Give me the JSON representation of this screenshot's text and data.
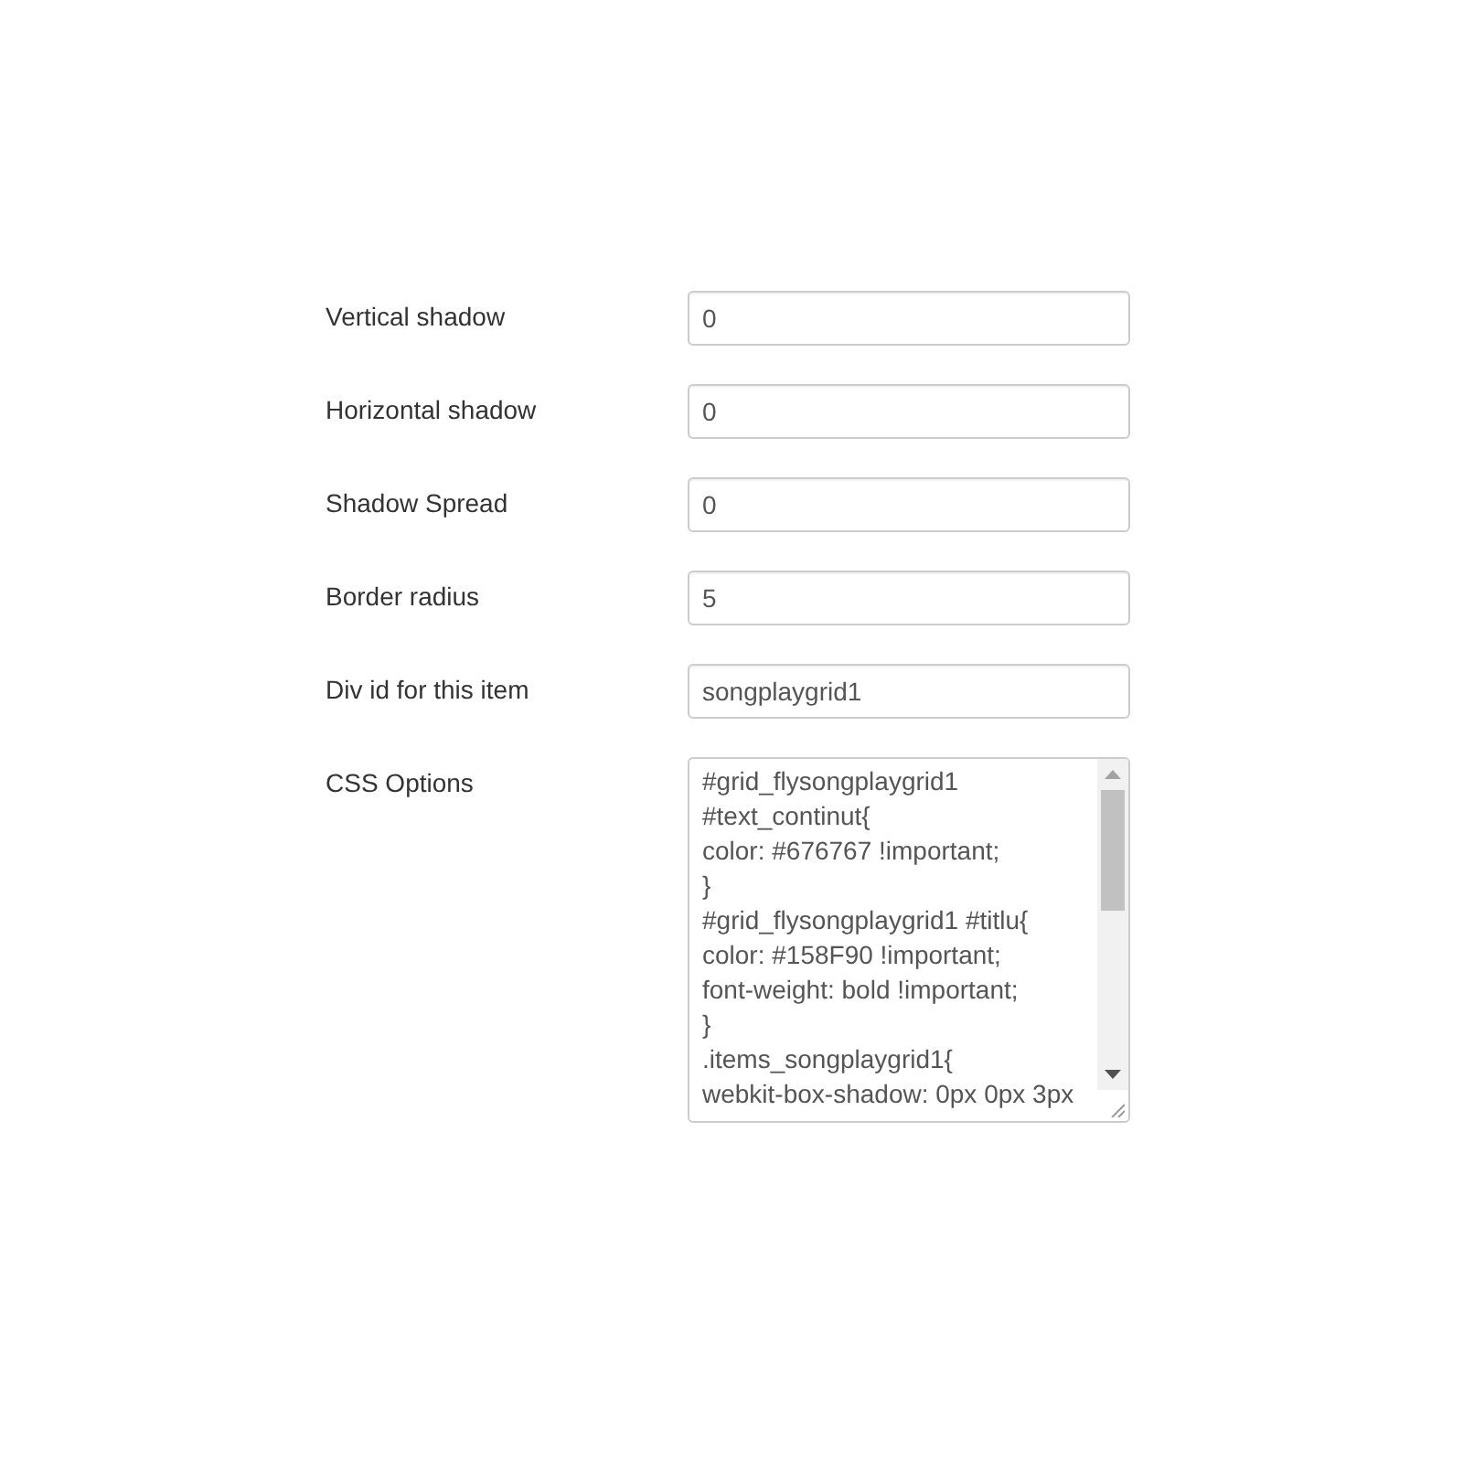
{
  "form": {
    "fields": [
      {
        "kind": "text",
        "label": "Vertical shadow",
        "value": "0"
      },
      {
        "kind": "text",
        "label": "Horizontal shadow",
        "value": "0"
      },
      {
        "kind": "text",
        "label": "Shadow Spread",
        "value": "0"
      },
      {
        "kind": "text",
        "label": "Border radius",
        "value": "5"
      },
      {
        "kind": "text",
        "label": "Div id for this item",
        "value": "songplaygrid1"
      },
      {
        "kind": "textarea",
        "label": "CSS Options",
        "lines": [
          "#grid_flysongplaygrid1",
          "#text_continut{",
          "color: #676767 !important;",
          "}",
          "#grid_flysongplaygrid1 #titlu{",
          "color: #158F90 !important;",
          "font-weight: bold !important;",
          "}",
          ".items_songplaygrid1{",
          "webkit-box-shadow: 0px 0px 3px"
        ]
      }
    ]
  }
}
